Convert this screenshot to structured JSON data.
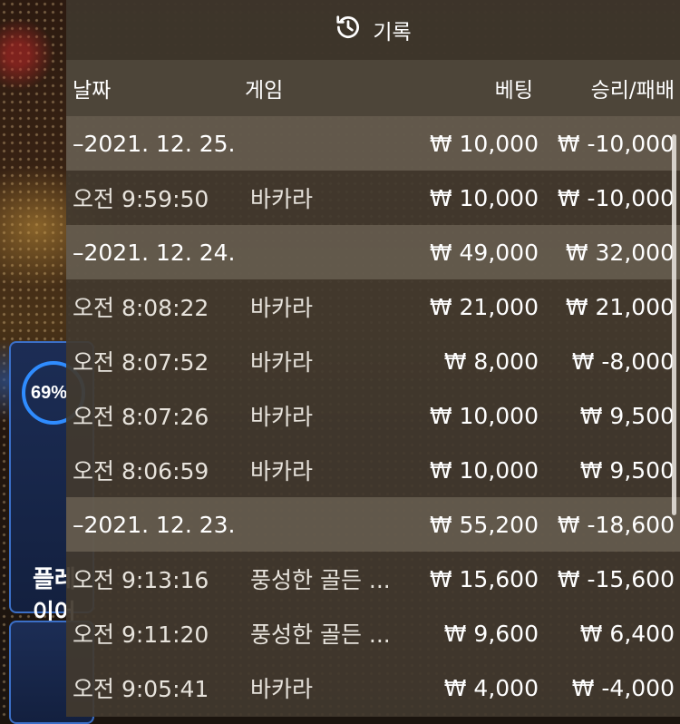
{
  "panel": {
    "title": "기록",
    "title_icon": "history-icon",
    "headers": {
      "date": "날짜",
      "game": "게임",
      "bet": "베팅",
      "result": "승리/패배"
    }
  },
  "background": {
    "gauge_percent": "69%",
    "side_label": "플레이어"
  },
  "groups": [
    {
      "date": "–2021. 12. 25.",
      "bet": "₩ 10,000",
      "result": "₩ -10,000",
      "items": [
        {
          "time": "오전 9:59:50",
          "game": "바카라",
          "bet": "₩ 10,000",
          "result": "₩ -10,000"
        }
      ]
    },
    {
      "date": "–2021. 12. 24.",
      "bet": "₩ 49,000",
      "result": "₩ 32,000",
      "items": [
        {
          "time": "오전 8:08:22",
          "game": "바카라",
          "bet": "₩ 21,000",
          "result": "₩ 21,000"
        },
        {
          "time": "오전 8:07:52",
          "game": "바카라",
          "bet": "₩ 8,000",
          "result": "₩ -8,000"
        },
        {
          "time": "오전 8:07:26",
          "game": "바카라",
          "bet": "₩ 10,000",
          "result": "₩ 9,500"
        },
        {
          "time": "오전 8:06:59",
          "game": "바카라",
          "bet": "₩ 10,000",
          "result": "₩ 9,500"
        }
      ]
    },
    {
      "date": "–2021. 12. 23.",
      "bet": "₩ 55,200",
      "result": "₩ -18,600",
      "items": [
        {
          "time": "오전 9:13:16",
          "game": "풍성한 골든 ...",
          "bet": "₩ 15,600",
          "result": "₩ -15,600"
        },
        {
          "time": "오전 9:11:20",
          "game": "풍성한 골든 ...",
          "bet": "₩ 9,600",
          "result": "₩ 6,400"
        },
        {
          "time": "오전 9:05:41",
          "game": "바카라",
          "bet": "₩ 4,000",
          "result": "₩ -4,000"
        }
      ]
    }
  ]
}
